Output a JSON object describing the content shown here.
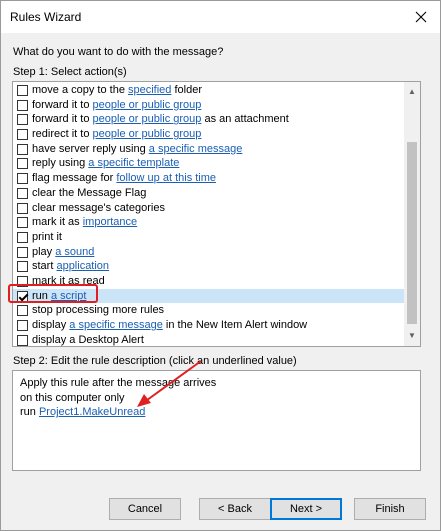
{
  "window": {
    "title": "Rules Wizard",
    "close_icon": "close-icon"
  },
  "question": "What do you want to do with the message?",
  "step1": {
    "label": "Step 1: Select action(s)",
    "items": [
      {
        "pre": "move a copy to the ",
        "link": "specified",
        "post": " folder",
        "checked": false
      },
      {
        "pre": "forward it to ",
        "link": "people or public group",
        "post": "",
        "checked": false
      },
      {
        "pre": "forward it to ",
        "link": "people or public group",
        "post": " as an attachment",
        "checked": false
      },
      {
        "pre": "redirect it to ",
        "link": "people or public group",
        "post": "",
        "checked": false
      },
      {
        "pre": "have server reply using ",
        "link": "a specific message",
        "post": "",
        "checked": false
      },
      {
        "pre": "reply using ",
        "link": "a specific template",
        "post": "",
        "checked": false
      },
      {
        "pre": "flag message for ",
        "link": "follow up at this time",
        "post": "",
        "checked": false
      },
      {
        "pre": "clear the Message Flag",
        "link": "",
        "post": "",
        "checked": false
      },
      {
        "pre": "clear message's categories",
        "link": "",
        "post": "",
        "checked": false
      },
      {
        "pre": "mark it as ",
        "link": "importance",
        "post": "",
        "checked": false
      },
      {
        "pre": "print it",
        "link": "",
        "post": "",
        "checked": false
      },
      {
        "pre": "play ",
        "link": "a sound",
        "post": "",
        "checked": false
      },
      {
        "pre": "start ",
        "link": "application",
        "post": "",
        "checked": false
      },
      {
        "pre": "mark it as read",
        "link": "",
        "post": "",
        "checked": false
      },
      {
        "pre": "run ",
        "link": "a script",
        "post": "",
        "checked": true,
        "selected": true
      },
      {
        "pre": "stop processing more rules",
        "link": "",
        "post": "",
        "checked": false
      },
      {
        "pre": "display ",
        "link": "a specific message",
        "post": " in the New Item Alert window",
        "checked": false
      },
      {
        "pre": "display a Desktop Alert",
        "link": "",
        "post": "",
        "checked": false
      }
    ]
  },
  "step2": {
    "label": "Step 2: Edit the rule description (click an underlined value)",
    "line1": "Apply this rule after the message arrives",
    "line2": "on this computer only",
    "line3_pre": "run ",
    "line3_link": "Project1.MakeUnread"
  },
  "buttons": {
    "cancel": "Cancel",
    "back": "< Back",
    "next": "Next >",
    "finish": "Finish"
  },
  "colors": {
    "link": "#1a5fb4",
    "annotation": "#e02020",
    "selection": "#cce4f7"
  }
}
